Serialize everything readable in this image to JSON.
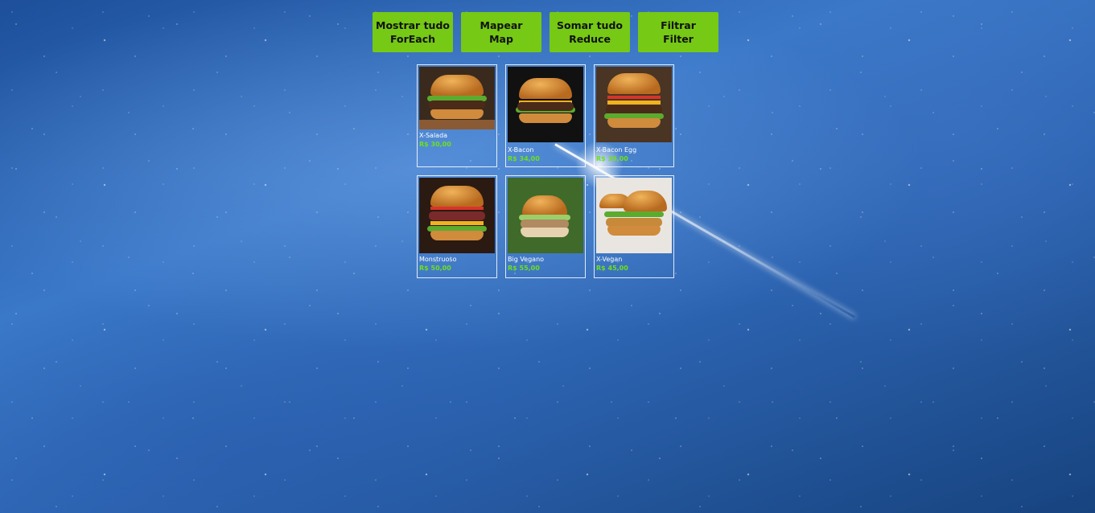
{
  "buttons": [
    {
      "line1": "Mostrar tudo",
      "line2": "ForEach"
    },
    {
      "line1": "Mapear",
      "line2": "Map"
    },
    {
      "line1": "Somar tudo",
      "line2": "Reduce"
    },
    {
      "line1": "Filtrar",
      "line2": "Filter"
    }
  ],
  "products": [
    {
      "name": "X-Salada",
      "price": "R$ 30,00"
    },
    {
      "name": "X-Bacon",
      "price": "R$ 34,00"
    },
    {
      "name": "X-Bacon Egg",
      "price": "R$ 39,00"
    },
    {
      "name": "Monstruoso",
      "price": "R$ 50,00"
    },
    {
      "name": "Big Vegano",
      "price": "R$ 55,00"
    },
    {
      "name": "X-Vegan",
      "price": "R$ 45,00"
    }
  ],
  "colors": {
    "button_bg": "#76c914",
    "price_text": "#6ee01c",
    "card_border": "#ffffff"
  },
  "icons": {
    "product_image": "burger-photo"
  }
}
